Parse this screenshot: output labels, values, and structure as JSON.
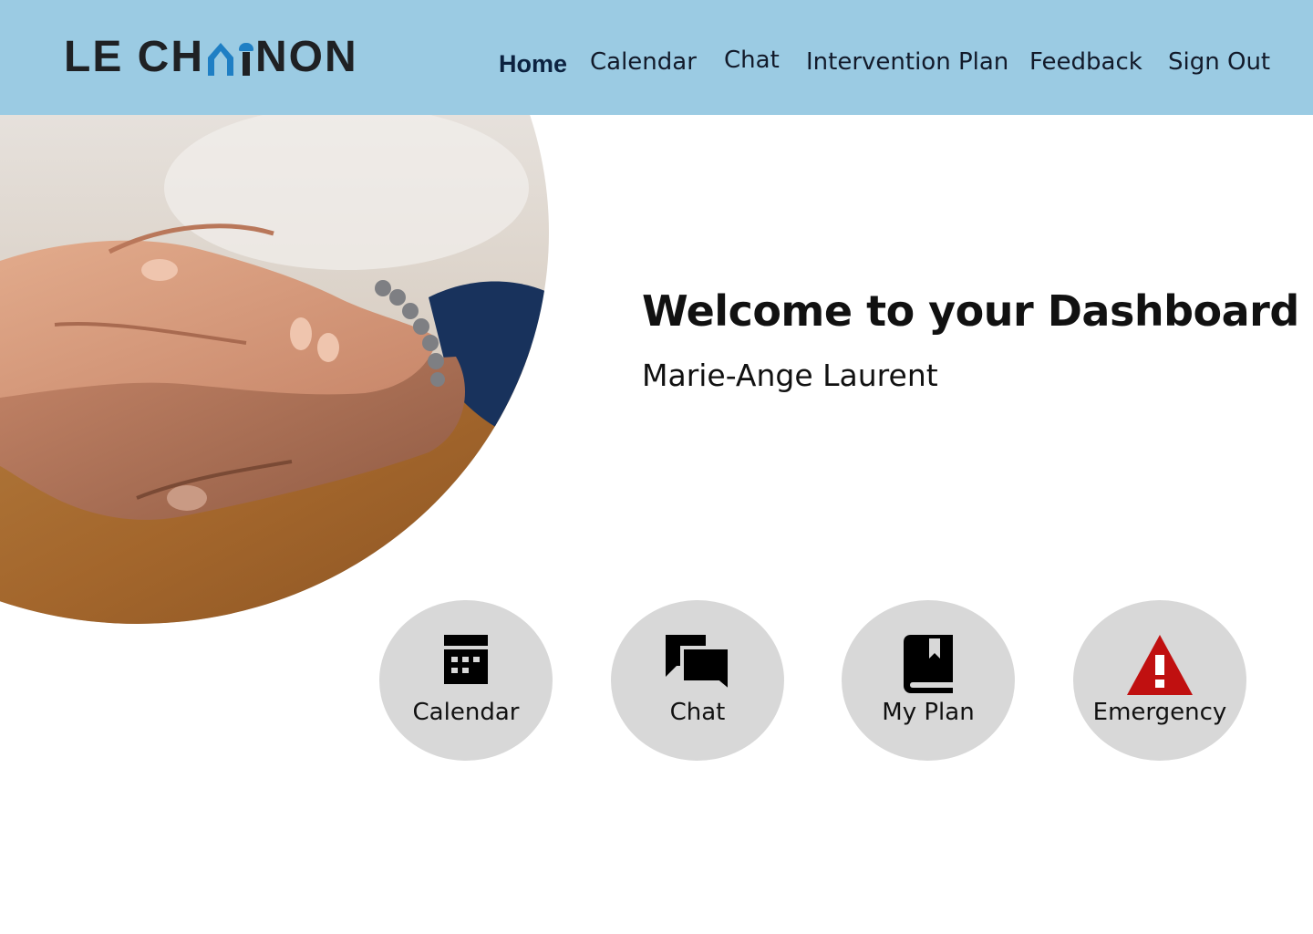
{
  "header": {
    "logo": {
      "part1": "LE CH",
      "part2": "NON",
      "full": "LE CHAINON"
    },
    "nav": [
      {
        "label": "Home",
        "active": true
      },
      {
        "label": "Calendar",
        "active": false
      },
      {
        "label": "Chat",
        "active": false
      },
      {
        "label": "Intervention Plan",
        "active": false
      },
      {
        "label": "Feedback",
        "active": false
      },
      {
        "label": "Sign Out",
        "active": false
      }
    ]
  },
  "main": {
    "welcome": "Welcome to your Dashboard",
    "user_name": "Marie-Ange Laurent",
    "hero_image": "hands-holding-photo",
    "tiles": [
      {
        "label": "Calendar",
        "icon": "calendar-icon"
      },
      {
        "label": "Chat",
        "icon": "chat-icon"
      },
      {
        "label": "My Plan",
        "icon": "book-icon"
      },
      {
        "label": "Emergency",
        "icon": "warning-icon"
      }
    ]
  },
  "colors": {
    "header_bg": "#9bcbe3",
    "logo_accent": "#1f7fc4",
    "tile_bg": "#d8d8d8",
    "emergency_red": "#c01010"
  }
}
